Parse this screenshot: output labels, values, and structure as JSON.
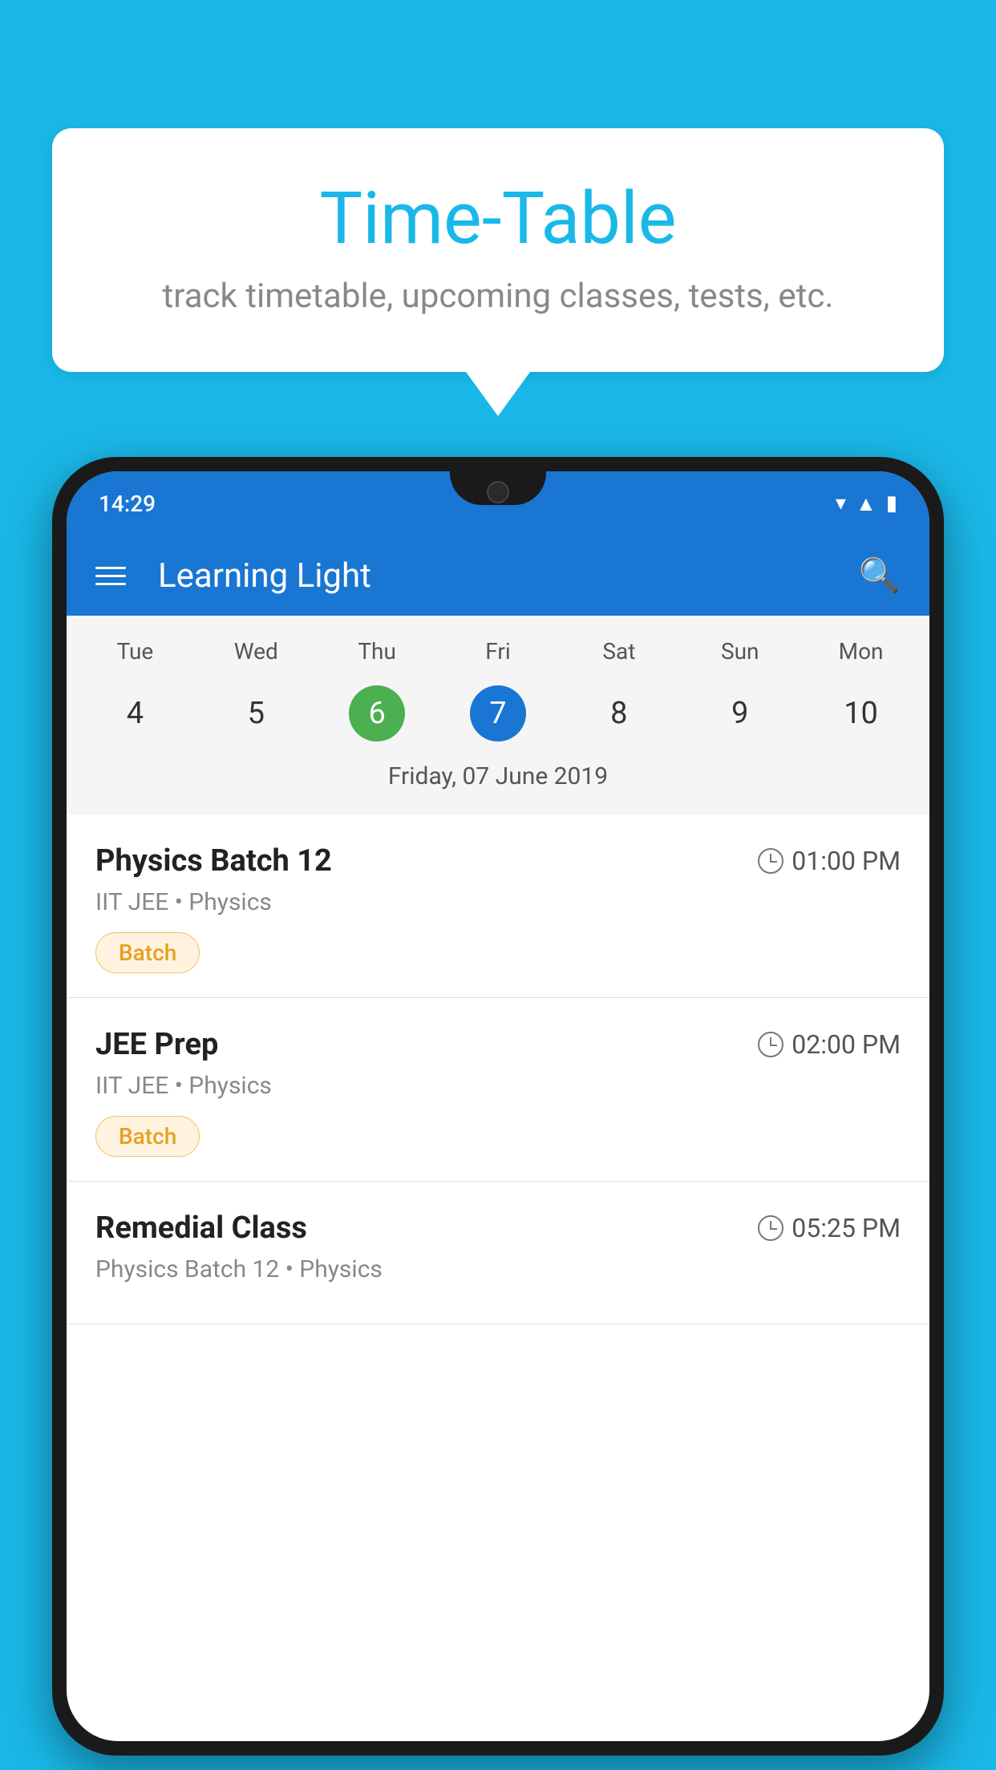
{
  "background_color": "#1ab8e8",
  "speech_bubble": {
    "title": "Time-Table",
    "subtitle": "track timetable, upcoming classes, tests, etc."
  },
  "phone": {
    "status_bar": {
      "time": "14:29"
    },
    "app_bar": {
      "title": "Learning Light"
    },
    "calendar": {
      "days": [
        {
          "label": "Tue",
          "number": "4"
        },
        {
          "label": "Wed",
          "number": "5"
        },
        {
          "label": "Thu",
          "number": "6",
          "state": "today"
        },
        {
          "label": "Fri",
          "number": "7",
          "state": "selected"
        },
        {
          "label": "Sat",
          "number": "8"
        },
        {
          "label": "Sun",
          "number": "9"
        },
        {
          "label": "Mon",
          "number": "10"
        }
      ],
      "selected_date": "Friday, 07 June 2019"
    },
    "schedule": [
      {
        "title": "Physics Batch 12",
        "time": "01:00 PM",
        "subtitle": "IIT JEE • Physics",
        "badge": "Batch"
      },
      {
        "title": "JEE Prep",
        "time": "02:00 PM",
        "subtitle": "IIT JEE • Physics",
        "badge": "Batch"
      },
      {
        "title": "Remedial Class",
        "time": "05:25 PM",
        "subtitle": "Physics Batch 12 • Physics",
        "badge": ""
      }
    ]
  }
}
